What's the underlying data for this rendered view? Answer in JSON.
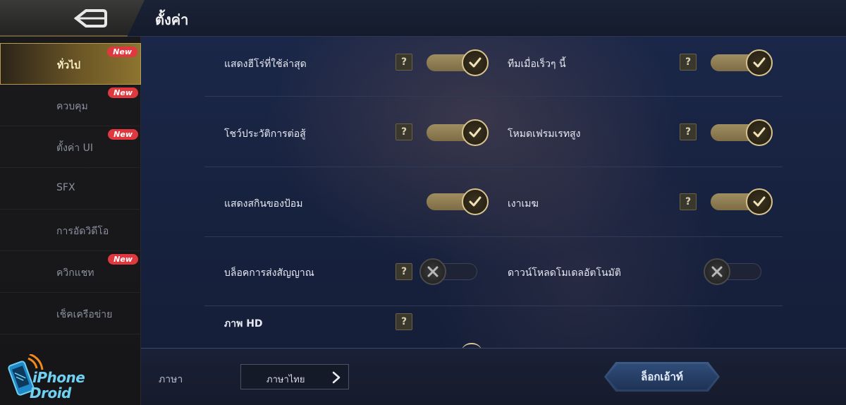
{
  "header": {
    "title": "ตั้งค่า"
  },
  "sidebar": {
    "items": [
      {
        "label": "ทั่วไป",
        "badge": "New",
        "active": true
      },
      {
        "label": "ควบคุม",
        "badge": "New",
        "active": false
      },
      {
        "label": "ตั้งค่า UI",
        "badge": "New",
        "active": false
      },
      {
        "label": "SFX",
        "badge": "",
        "active": false
      },
      {
        "label": "การอัดวิดีโอ",
        "badge": "",
        "active": false
      },
      {
        "label": "ควิกแชท",
        "badge": "New",
        "active": false
      },
      {
        "label": "เช็คเครือข่าย",
        "badge": "",
        "active": false
      }
    ]
  },
  "settings": {
    "row1": {
      "left": {
        "label": "แสดงฮีโร่ที่ใช้ล่าสุด",
        "help": "?",
        "on": true
      },
      "right": {
        "label": "ทีมเมื่อเร็วๆ นี้",
        "help": "?",
        "on": true
      }
    },
    "row2": {
      "left": {
        "label": "โชว์ประวัติการต่อสู้",
        "help": "?",
        "on": true
      },
      "right": {
        "label": "โหมดเฟรมเรทสูง",
        "help": "?",
        "on": true
      }
    },
    "row3": {
      "left": {
        "label": "แสดงสกินของป้อม",
        "on": true
      },
      "right": {
        "label": "เงาเมฆ",
        "help": "?",
        "on": true
      }
    },
    "row4": {
      "left": {
        "label": "บล็อคการส่งสัญญาณ",
        "help": "?",
        "on": false
      },
      "right": {
        "label": "ดาวน์โหลดโมเดลอัตโนมัติ",
        "on": false
      }
    },
    "row5": {
      "left": {
        "label": "ภาพ HD",
        "help": "?"
      }
    }
  },
  "footer": {
    "language_label": "ภาษา",
    "language_value": "ภาษาไทย",
    "logout_label": "ล็อกเอ้าท์"
  },
  "watermark": {
    "line1": "iPhone",
    "line2": "Droid"
  },
  "colors": {
    "accent_gold": "#d9c48e",
    "badge_red": "#e0383f",
    "button_blue": "#2f4c78",
    "watermark_blue": "#6fd0f2"
  }
}
